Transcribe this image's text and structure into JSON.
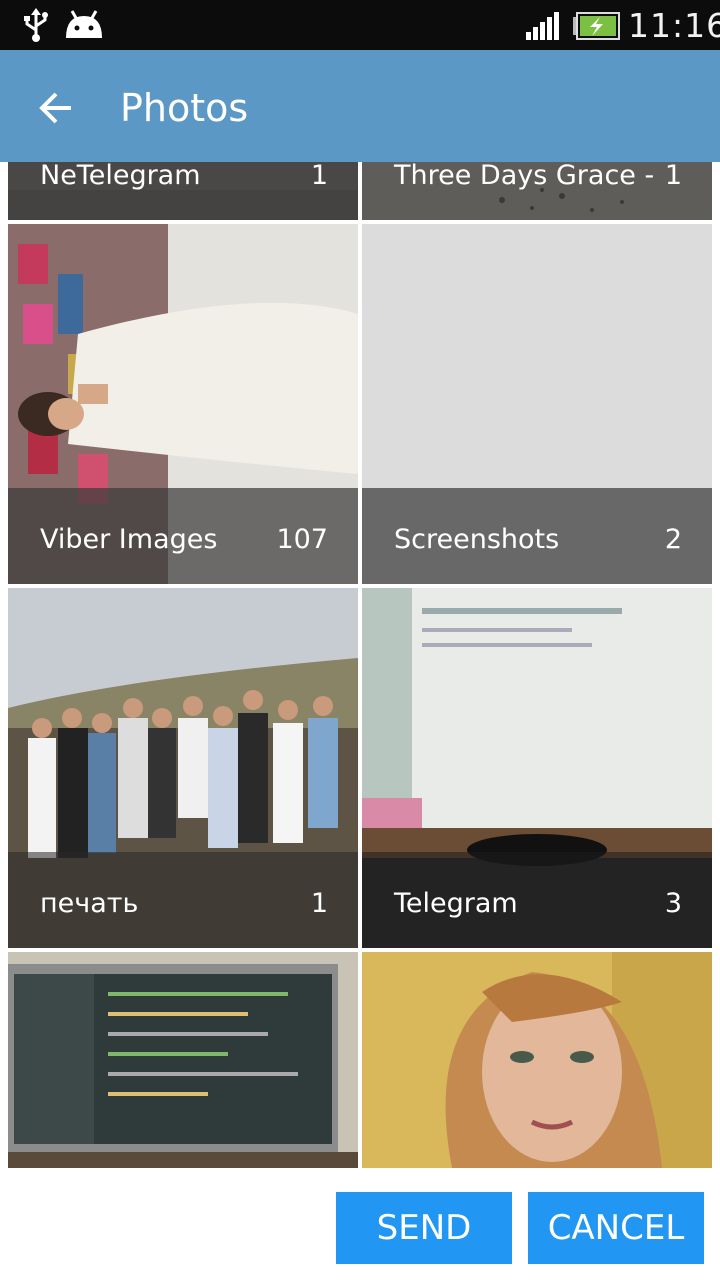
{
  "status_bar": {
    "time": "11:16",
    "icons": [
      "usb-icon",
      "android-debug-icon",
      "signal-icon",
      "battery-charging-icon"
    ]
  },
  "header": {
    "title": "Photos",
    "back_icon": "arrow-left-icon"
  },
  "albums": [
    {
      "name": "NeTelegram",
      "count": "1"
    },
    {
      "name": "Three Days Grace -",
      "count": "1"
    },
    {
      "name": "Viber Images",
      "count": "107"
    },
    {
      "name": "Screenshots",
      "count": "2"
    },
    {
      "name": "печать",
      "count": "1"
    },
    {
      "name": "Telegram",
      "count": "3"
    }
  ],
  "actions": {
    "send_label": "SEND",
    "cancel_label": "CANCEL"
  },
  "colors": {
    "action_bar": "#5c98c6",
    "button": "#2196f3",
    "status_bar": "#0c0c0c"
  }
}
